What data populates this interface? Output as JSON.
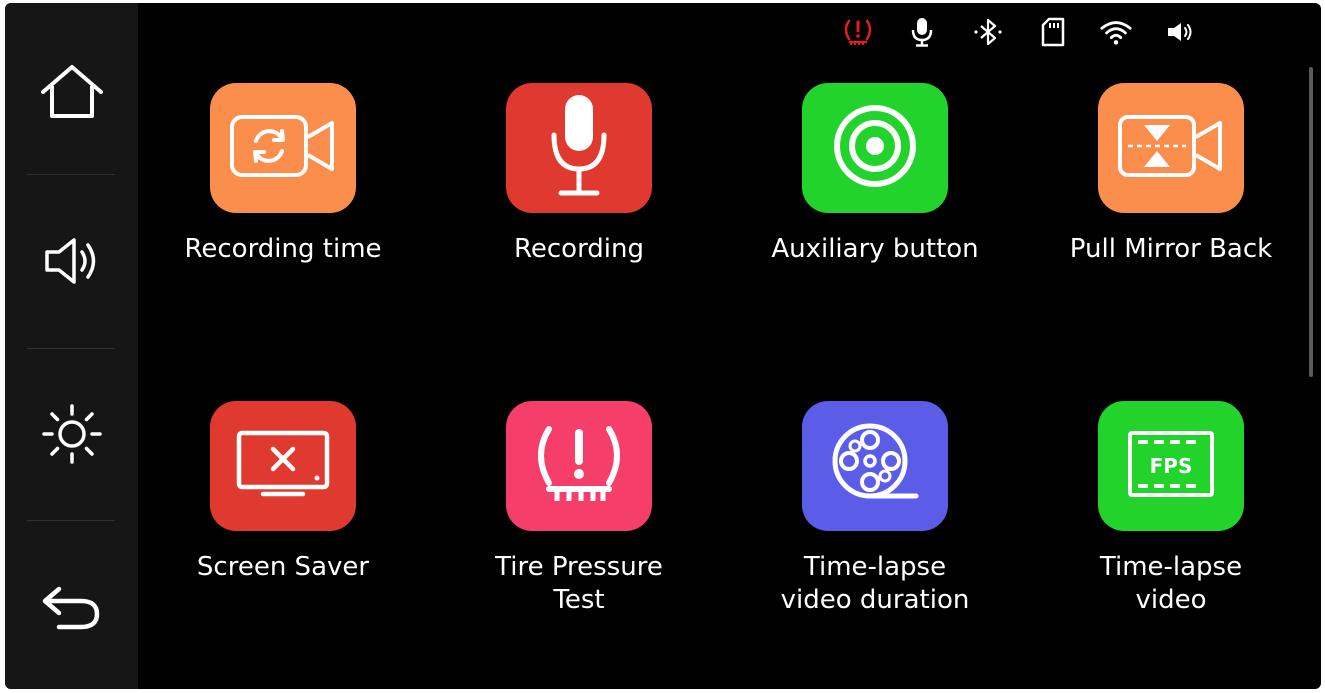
{
  "colors": {
    "background": "#000000",
    "sidebar": "#161616",
    "alert": "#e02020",
    "white": "#ffffff"
  },
  "sidebar": {
    "items": [
      {
        "icon": "home-icon"
      },
      {
        "icon": "volume-icon"
      },
      {
        "icon": "brightness-icon"
      },
      {
        "icon": "back-icon"
      }
    ]
  },
  "status_bar": {
    "icons": [
      "tire-pressure-alert-icon",
      "microphone-icon",
      "bluetooth-icon",
      "sd-card-icon",
      "wifi-icon",
      "speaker-icon"
    ]
  },
  "apps": [
    {
      "label": "Recording time",
      "icon": "loop-recording-icon",
      "color": "#fb8e4c"
    },
    {
      "label": "Recording",
      "icon": "microphone-icon",
      "color": "#e03a30"
    },
    {
      "label": "Auxiliary button",
      "icon": "target-icon",
      "color": "#22d32c"
    },
    {
      "label": "Pull Mirror Back",
      "icon": "mirror-flip-icon",
      "color": "#fb8e4c"
    },
    {
      "label": "Screen Saver",
      "icon": "screen-off-icon",
      "color": "#e03a30"
    },
    {
      "label": "Tire Pressure\nTest",
      "icon": "tire-pressure-icon",
      "color": "#f63e6a"
    },
    {
      "label": "Time-lapse\nvideo duration",
      "icon": "film-reel-icon",
      "color": "#5b5de8"
    },
    {
      "label": "Time-lapse\nvideo",
      "icon": "fps-icon",
      "color": "#22d32c"
    }
  ]
}
